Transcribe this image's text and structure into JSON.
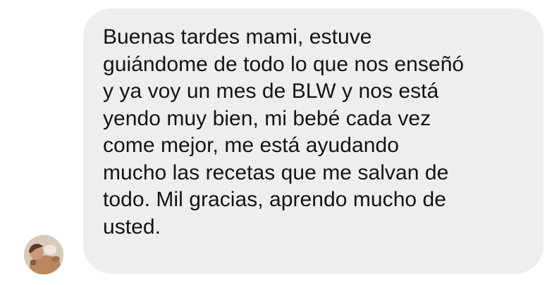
{
  "conversation": {
    "sender_avatar": {
      "icon": "user-photo-avatar",
      "colors": {
        "background": "#d8c9bb",
        "skin": "#c99a78",
        "hair": "#5a3a28",
        "shirt": "#b9875d"
      }
    },
    "message": {
      "bubble_color": "#eeeeee",
      "text_color": "#141414",
      "lines": [
        "Buenas tardes mami, estuve",
        "guiándome de todo lo que nos enseñó",
        "y ya voy un mes de BLW y nos está",
        "yendo muy bien, mi bebé cada vez",
        "come mejor, me está ayudando",
        "mucho las recetas que me salvan de",
        "todo. Mil gracias, aprendo mucho de",
        "usted."
      ]
    }
  }
}
